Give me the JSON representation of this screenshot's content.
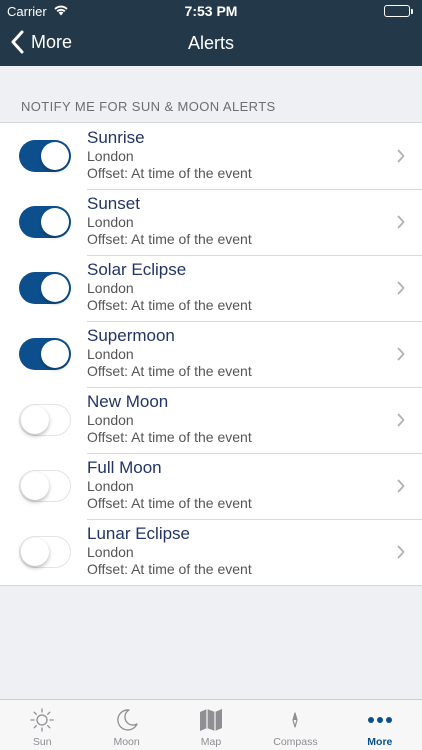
{
  "status_bar": {
    "carrier": "Carrier",
    "time": "7:53 PM"
  },
  "nav": {
    "back_label": "More",
    "title": "Alerts"
  },
  "section_header": "NOTIFY ME FOR SUN & MOON ALERTS",
  "alerts": [
    {
      "title": "Sunrise",
      "location": "London",
      "offset": "Offset: At time of the event",
      "enabled": true
    },
    {
      "title": "Sunset",
      "location": "London",
      "offset": "Offset: At time of the event",
      "enabled": true
    },
    {
      "title": "Solar Eclipse",
      "location": "London",
      "offset": "Offset: At time of the event",
      "enabled": true
    },
    {
      "title": "Supermoon",
      "location": "London",
      "offset": "Offset: At time of the event",
      "enabled": true
    },
    {
      "title": "New Moon",
      "location": "London",
      "offset": "Offset: At time of the event",
      "enabled": false
    },
    {
      "title": "Full Moon",
      "location": "London",
      "offset": "Offset: At time of the event",
      "enabled": false
    },
    {
      "title": "Lunar Eclipse",
      "location": "London",
      "offset": "Offset: At time of the event",
      "enabled": false
    }
  ],
  "tabs": [
    {
      "label": "Sun",
      "icon": "sun-icon",
      "active": false
    },
    {
      "label": "Moon",
      "icon": "moon-icon",
      "active": false
    },
    {
      "label": "Map",
      "icon": "map-icon",
      "active": false
    },
    {
      "label": "Compass",
      "icon": "compass-icon",
      "active": false
    },
    {
      "label": "More",
      "icon": "more-icon",
      "active": true
    }
  ],
  "colors": {
    "nav_bg": "#233848",
    "accent": "#0d4f8c",
    "battery": "#4cd964"
  }
}
